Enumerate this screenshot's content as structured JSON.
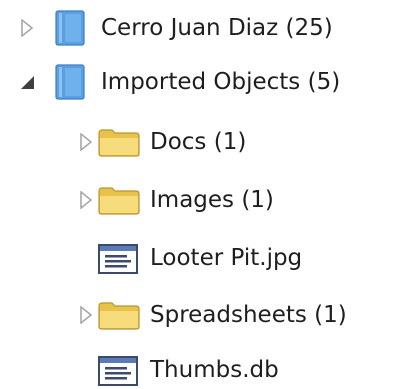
{
  "tree": {
    "items": [
      {
        "label": "Cerro Juan Diaz (25)",
        "icon": "project-icon",
        "expander": "collapsed",
        "level": 0
      },
      {
        "label": "Imported Objects (5)",
        "icon": "project-icon",
        "expander": "expanded",
        "level": 0
      },
      {
        "label": "Docs (1)",
        "icon": "folder-icon",
        "expander": "collapsed",
        "level": 1
      },
      {
        "label": "Images (1)",
        "icon": "folder-icon",
        "expander": "collapsed",
        "level": 1
      },
      {
        "label": "Looter Pit.jpg",
        "icon": "file-icon",
        "expander": "none",
        "level": 1
      },
      {
        "label": "Spreadsheets (1)",
        "icon": "folder-icon",
        "expander": "collapsed",
        "level": 1
      },
      {
        "label": "Thumbs.db",
        "icon": "file-icon",
        "expander": "none",
        "level": 1
      }
    ]
  },
  "colors": {
    "project_icon": "#5aa0e0",
    "folder_icon": "#f2d262",
    "expander_collapsed": "#a8a8a8",
    "expander_expanded": "#404040",
    "text": "#1e1e1e"
  }
}
